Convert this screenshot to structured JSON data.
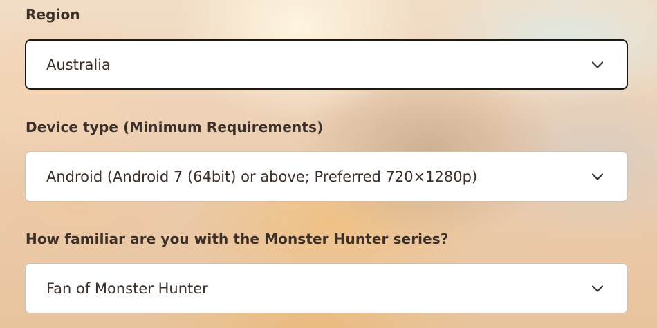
{
  "form": {
    "fields": [
      {
        "label": "Region",
        "value": "Australia",
        "icon": "chevron-down-icon",
        "focused": true
      },
      {
        "label": "Device type (Minimum Requirements)",
        "value": "Android (Android 7 (64bit) or above; Preferred 720×1280p)",
        "icon": "chevron-down-icon",
        "focused": false
      },
      {
        "label": "How familiar are you with the Monster Hunter series?",
        "value": "Fan of Monster Hunter",
        "icon": "chevron-down-icon",
        "focused": false
      }
    ]
  },
  "colors": {
    "label_text": "#3b2f28",
    "value_text": "#3b2f28",
    "field_background": "#ffffff",
    "field_border": "#c9c3bd",
    "focused_border": "#1a1a1a"
  }
}
